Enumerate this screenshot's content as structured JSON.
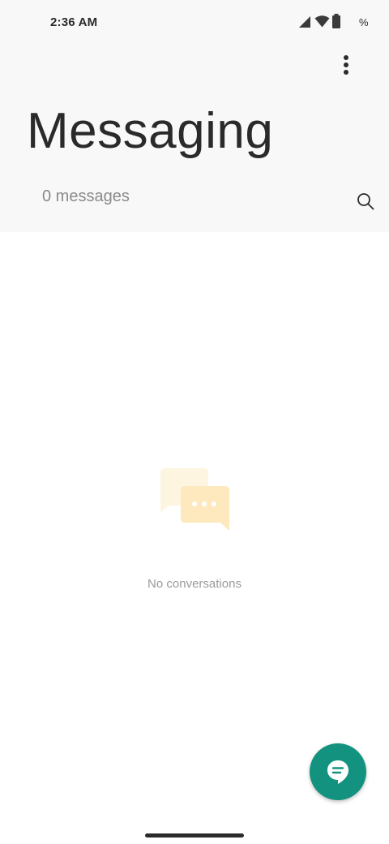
{
  "status_bar": {
    "time": "2:36 AM",
    "battery_text": "%"
  },
  "header": {
    "title": "Messaging",
    "message_count": "0 messages"
  },
  "empty_state": {
    "text": "No conversations"
  },
  "icons": {
    "signal": "signal-icon",
    "wifi": "wifi-icon",
    "battery": "battery-icon",
    "more": "more-vert-icon",
    "search": "search-icon",
    "empty": "chat-bubbles-icon",
    "new_message": "new-message-icon"
  },
  "colors": {
    "accent": "#13937f",
    "header_bg": "#f8f8f8",
    "illustration": "#fde9bd"
  }
}
